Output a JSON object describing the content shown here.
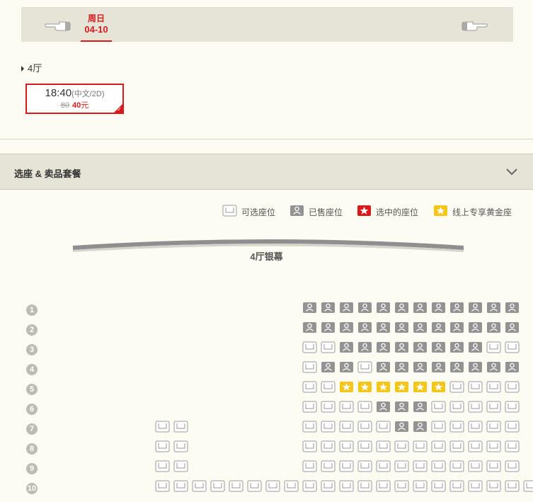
{
  "date_bar": {
    "day": "周日",
    "date": "04-10"
  },
  "hall": {
    "label": "4厅"
  },
  "showtime": {
    "time": "18:40",
    "format": "(中文/2D)",
    "original_price": "80",
    "price": "40",
    "unit": "元"
  },
  "section": {
    "title": "选座 & 卖品套餐"
  },
  "legend": {
    "available": "可选座位",
    "sold": "已售座位",
    "selected": "选中的座位",
    "golden": "线上专享黄金座"
  },
  "screen": {
    "label": "4厅银幕"
  },
  "colors": {
    "accent": "#d81a1a",
    "sold": "#939393",
    "golden": "#f5c518"
  },
  "seat_rows": [
    {
      "num": "1",
      "seats": "............SSSSSSSSSSSS.."
    },
    {
      "num": "2",
      "seats": "............SSSSSSSSSSSS.."
    },
    {
      "num": "3",
      "seats": "............AASSSSSSSSAA.."
    },
    {
      "num": "4",
      "seats": "............ASSASSSSSSSS.."
    },
    {
      "num": "5",
      "seats": "............AAGGGGGGAAAA.."
    },
    {
      "num": "6",
      "seats": "............AAAASSSAAAAA.."
    },
    {
      "num": "7",
      "seats": "....AA......AAAAASSAAAAA.."
    },
    {
      "num": "8",
      "seats": "....AA......AAAAAAAAAAAA.."
    },
    {
      "num": "9",
      "seats": "....AA......AAAAAAAAAAAA.."
    },
    {
      "num": "10",
      "seats": "....AAAAAAAAAAAAAAAAAAAAAA"
    }
  ]
}
